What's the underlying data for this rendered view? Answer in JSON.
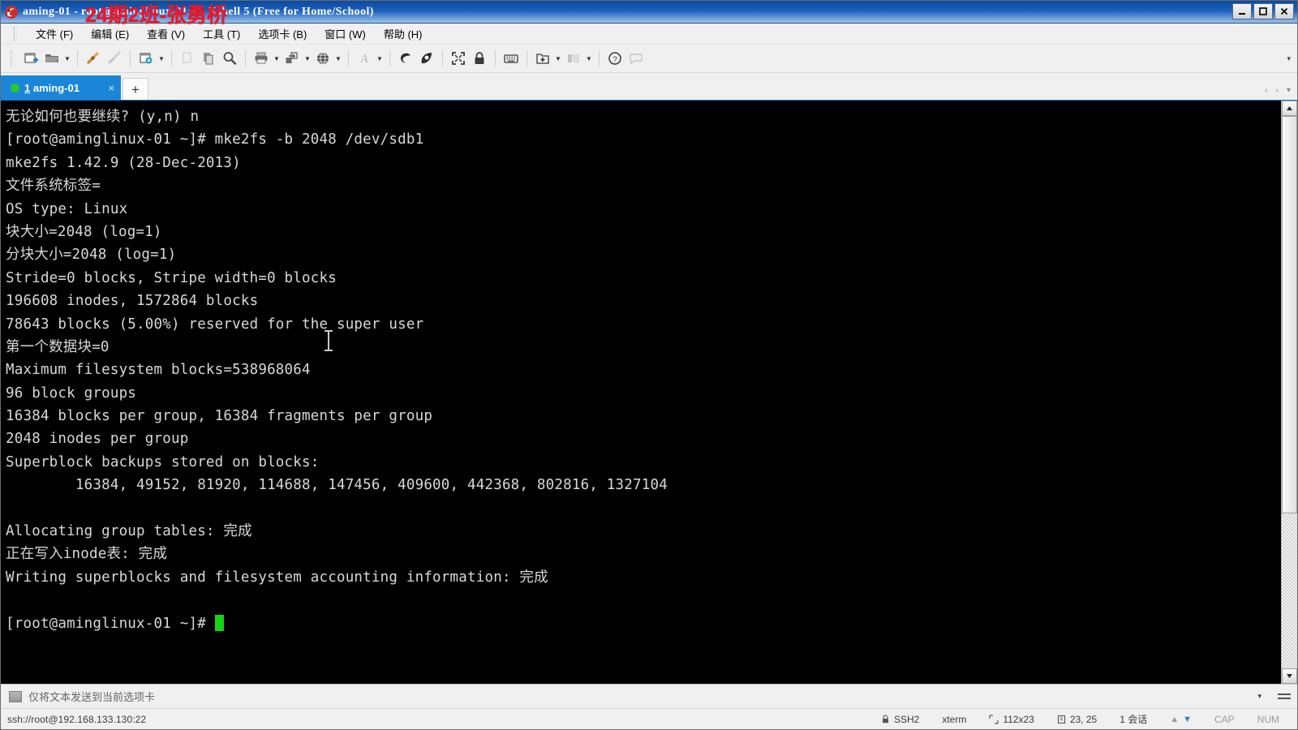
{
  "window": {
    "title": "aming-01 - root@aminglinux-01:~ - Xshell 5 (Free for Home/School)",
    "overlay_watermark": "24期2班-张勇桥",
    "logo_icon": "xshell-logo-icon",
    "controls": {
      "minimize": "minimize-icon",
      "maximize": "maximize-icon",
      "close": "close-icon"
    }
  },
  "menu": {
    "items": [
      {
        "label": "文件 (F)",
        "name": "menu-file"
      },
      {
        "label": "编辑 (E)",
        "name": "menu-edit"
      },
      {
        "label": "查看 (V)",
        "name": "menu-view"
      },
      {
        "label": "工具 (T)",
        "name": "menu-tools"
      },
      {
        "label": "选项卡 (B)",
        "name": "menu-tabs"
      },
      {
        "label": "窗口 (W)",
        "name": "menu-window"
      },
      {
        "label": "帮助 (H)",
        "name": "menu-help"
      }
    ]
  },
  "toolbar": {
    "overflow_label": "▾",
    "buttons": [
      {
        "name": "new-session-icon",
        "tooltip": "新建会话"
      },
      {
        "name": "open-folder-icon",
        "tooltip": "打开"
      },
      {
        "name": "connect-icon",
        "tooltip": "连接"
      },
      {
        "name": "disconnect-icon",
        "tooltip": "断开"
      },
      {
        "name": "session-properties-icon",
        "tooltip": "属性"
      },
      {
        "name": "copy-page-icon",
        "tooltip": "复制"
      },
      {
        "name": "paste-icon",
        "tooltip": "粘贴"
      },
      {
        "name": "find-icon",
        "tooltip": "查找"
      },
      {
        "name": "print-icon",
        "tooltip": "打印"
      },
      {
        "name": "transfer-icon",
        "tooltip": "传输"
      },
      {
        "name": "globe-icon",
        "tooltip": "编码"
      },
      {
        "name": "font-icon",
        "tooltip": "字体"
      },
      {
        "name": "xftp-icon",
        "tooltip": "Xftp"
      },
      {
        "name": "xagent-icon",
        "tooltip": "Xagent"
      },
      {
        "name": "fullscreen-icon",
        "tooltip": "全屏"
      },
      {
        "name": "lock-icon",
        "tooltip": "锁定"
      },
      {
        "name": "keyboard-icon",
        "tooltip": "键盘"
      },
      {
        "name": "add-tab-icon",
        "tooltip": "新建选项卡"
      },
      {
        "name": "layout-icon",
        "tooltip": "布局"
      },
      {
        "name": "help-icon",
        "tooltip": "帮助"
      },
      {
        "name": "feedback-icon",
        "tooltip": "反馈"
      }
    ]
  },
  "tabs": {
    "items": [
      {
        "index": "1",
        "label": "aming-01",
        "status": "connected",
        "close_label": "×",
        "name": "tab-aming-01"
      }
    ],
    "add_label": "+",
    "nav_prev": "‹",
    "nav_next": "›",
    "nav_menu": "▾"
  },
  "terminal": {
    "prompt": "[root@aminglinux-01 ~]#",
    "lines": [
      "无论如何也要继续? (y,n) n",
      "[root@aminglinux-01 ~]# mke2fs -b 2048 /dev/sdb1",
      "mke2fs 1.42.9 (28-Dec-2013)",
      "文件系统标签=",
      "OS type: Linux",
      "块大小=2048 (log=1)",
      "分块大小=2048 (log=1)",
      "Stride=0 blocks, Stripe width=0 blocks",
      "196608 inodes, 1572864 blocks",
      "78643 blocks (5.00%) reserved for the super user",
      "第一个数据块=0",
      "Maximum filesystem blocks=538968064",
      "96 block groups",
      "16384 blocks per group, 16384 fragments per group",
      "2048 inodes per group",
      "Superblock backups stored on blocks:",
      "        16384, 49152, 81920, 114688, 147456, 409600, 442368, 802816, 1327104",
      "",
      "Allocating group tables: 完成",
      "正在写入inode表: 完成",
      "Writing superblocks and filesystem accounting information: 完成",
      ""
    ],
    "last_prompt_line": "[root@aminglinux-01 ~]# ",
    "cursor": "block",
    "colors": {
      "background": "#000000",
      "foreground": "#d8d8d8",
      "cursor": "#18d418"
    }
  },
  "send_bar": {
    "icon": "send-to-tab-icon",
    "text": "仅将文本发送到当前选项卡",
    "caret": "▾",
    "menu_icon": "hamburger-menu-icon"
  },
  "status_bar": {
    "url": "ssh://root@192.168.133.130:22",
    "lock_icon": "lock-icon",
    "protocol": "SSH2",
    "terminal_type": "xterm",
    "size_icon": "screen-size-icon",
    "size": "112x23",
    "cursor_icon": "cursor-position-icon",
    "cursor_pos": "23, 25",
    "sessions_icon": "sessions-icon",
    "sessions": "1 会话",
    "upload_arrow": "▲",
    "download_arrow": "▼",
    "cap": "CAP",
    "num": "NUM"
  }
}
